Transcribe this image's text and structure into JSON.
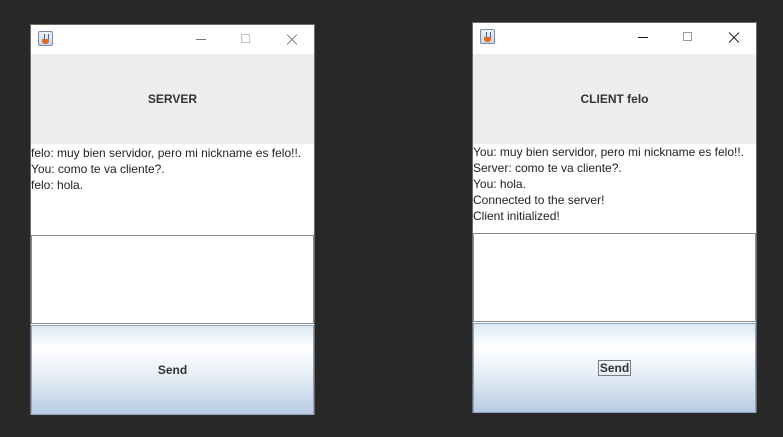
{
  "server_window": {
    "header_title": "SERVER",
    "log_lines": [
      "felo: muy bien servidor, pero mi nickname es felo!!.",
      "You: como te va cliente?.",
      "felo: hola."
    ],
    "input_value": "",
    "send_label": "Send"
  },
  "client_window": {
    "header_title": "CLIENT felo",
    "log_lines": [
      "You: muy bien servidor, pero mi nickname es felo!!.",
      "Server: como te va cliente?.",
      "You: hola.",
      "Connected to the server!",
      "Client initialized!"
    ],
    "input_value": "",
    "send_label": "Send"
  },
  "icons": {
    "app": "java-cup-icon",
    "minimize": "minimize-icon",
    "maximize": "maximize-icon",
    "close": "close-icon"
  },
  "colors": {
    "desktop_background": "#282828",
    "header_panel": "#eeeeee",
    "button_gradient_bottom": "#b8cce4"
  }
}
